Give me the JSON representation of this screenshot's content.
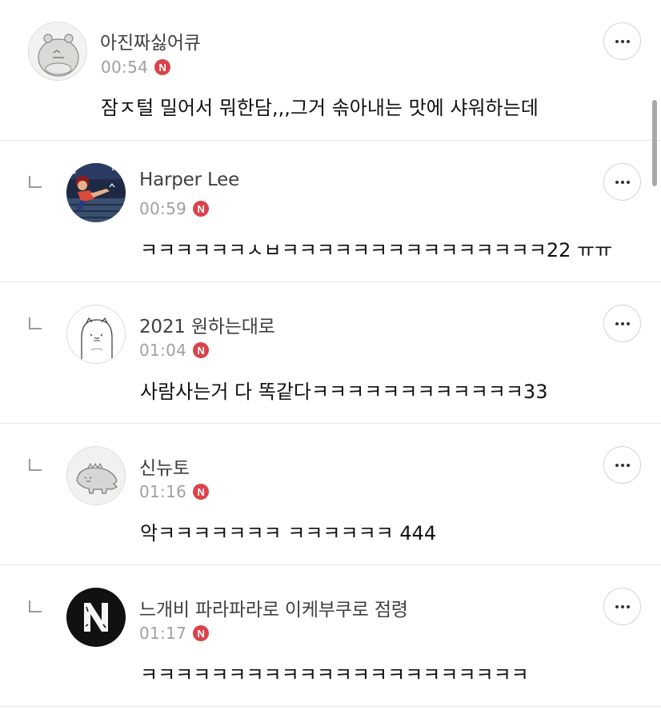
{
  "comments": [
    {
      "nickname": "아진짜싫어큐",
      "time": "00:54",
      "badge": "N",
      "text": "잠ㅈ털 밀어서 뭐한담,,,그거 솎아내는  맛에 샤워하는데",
      "avatar": "hippo-avatar"
    },
    {
      "nickname": "Harper Lee",
      "time": "00:59",
      "badge": "N",
      "text": "ㅋㅋㅋㅋㅋㅋㅅㅂㅋㅋㅋㅋㅋㅋㅋㅋㅋㅋㅋㅋㅋㅋㅋ22 ㅠㅠ",
      "avatar": "photo-avatar"
    },
    {
      "nickname": "2021 원하는대로",
      "time": "01:04",
      "badge": "N",
      "text": "사람사는거 다 똑같다ㅋㅋㅋㅋㅋㅋㅋㅋㅋㅋㅋㅋ33",
      "avatar": "cat-avatar"
    },
    {
      "nickname": "신뉴토",
      "time": "01:16",
      "badge": "N",
      "text": "악ㅋㅋㅋㅋㅋㅋㅋ ㅋㅋㅋㅋㅋㅋ 444",
      "avatar": "dino-avatar"
    },
    {
      "nickname": "느개비 파라파라로 이케부쿠로 점령",
      "time": "01:17",
      "badge": "N",
      "text": "ㅋㅋㅋㅋㅋㅋㅋㅋㅋㅋㅋㅋㅋㅋㅋㅋㅋㅋㅋㅋㅋㅋ",
      "avatar": "n-logo-avatar"
    }
  ],
  "colors": {
    "badge": "#d9444a",
    "divider": "#e6e6e6",
    "time": "#a0a0a0"
  },
  "icons": {
    "more": "more-options-icon",
    "reply": "reply-indent-icon",
    "badge": "new-badge-icon"
  }
}
